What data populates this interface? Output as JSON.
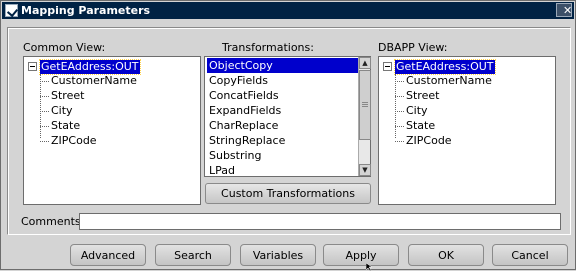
{
  "window": {
    "title": "Mapping Parameters",
    "close_glyph": "✕"
  },
  "common_view": {
    "label": "Common View:",
    "root": "GetEAddress:OUT",
    "children": [
      "CustomerName",
      "Street",
      "City",
      "State",
      "ZIPCode"
    ]
  },
  "transformations": {
    "label": "Transformations:",
    "items": [
      "ObjectCopy",
      "CopyFields",
      "ConcatFields",
      "ExpandFields",
      "CharReplace",
      "StringReplace",
      "Substring",
      "LPad"
    ],
    "selected": "ObjectCopy",
    "custom_button": "Custom Transformations",
    "scroll_up_glyph": "▲",
    "scroll_down_glyph": "▼"
  },
  "dbapp_view": {
    "label": "DBAPP View:",
    "root": "GetEAddress:OUT",
    "children": [
      "CustomerName",
      "Street",
      "City",
      "State",
      "ZIPCode"
    ]
  },
  "comments": {
    "label": "Comments",
    "value": ""
  },
  "buttons": {
    "advanced": "Advanced",
    "search": "Search",
    "variables": "Variables",
    "apply": "Apply",
    "ok": "OK",
    "cancel": "Cancel"
  },
  "colors": {
    "selection": "#0000cc",
    "titlebar": "#002244",
    "background": "#d4d4d4"
  }
}
